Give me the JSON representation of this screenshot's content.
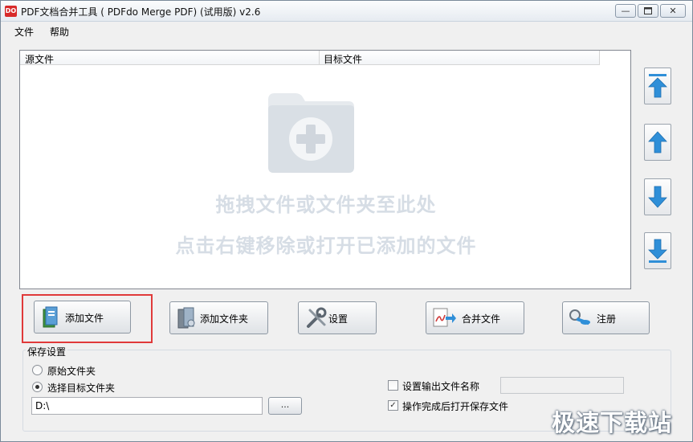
{
  "window": {
    "app_icon_text": "DO",
    "title": "PDF文档合并工具 ( PDFdo Merge PDF) (试用版) v2.6"
  },
  "menu": [
    "文件",
    "帮助"
  ],
  "file_list": {
    "columns": [
      "源文件",
      "目标文件"
    ],
    "hint_line1": "拖拽文件或文件夹至此处",
    "hint_line2": "点击右键移除或打开已添加的文件"
  },
  "toolbar": {
    "add_file": "添加文件",
    "add_folder": "添加文件夹",
    "settings": "设置",
    "merge": "合并文件",
    "register": "注册"
  },
  "save_settings": {
    "group_title": "保存设置",
    "radio_original": "原始文件夹",
    "radio_target": "选择目标文件夹",
    "selected": "target",
    "path_value": "D:\\",
    "browse_label": "...",
    "check_output_name": "设置输出文件名称",
    "check_output_name_checked": false,
    "check_open_after": "操作完成后打开保存文件",
    "check_open_after_checked": true
  },
  "watermark": "极速下载站",
  "colors": {
    "accent_arrow": "#2f8fd8",
    "highlight_border": "#e03a3a",
    "hint_text": "#d6dde5"
  },
  "icons": {
    "side_buttons": [
      "move-to-top-icon",
      "move-up-icon",
      "move-down-icon",
      "move-to-bottom-icon"
    ]
  }
}
